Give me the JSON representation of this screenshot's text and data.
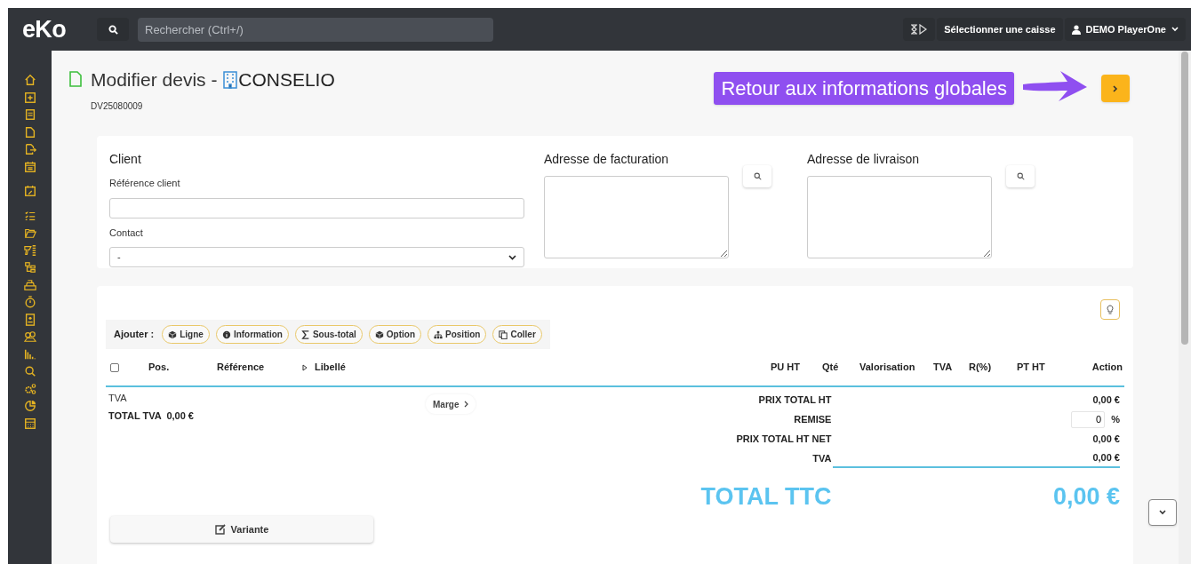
{
  "top_bar": {
    "logo": "eKo",
    "search": {
      "placeholder": "Rechercher (Ctrl+/)"
    },
    "cash_register_button": "Sélectionner une caisse",
    "user_menu": "DEMO PlayerOne"
  },
  "header": {
    "title": "Modifier devis - ",
    "client_name": "CONSELIO",
    "quote_number": "DV25080009",
    "callout": "Retour aux informations globales"
  },
  "client_card": {
    "heading": "Client",
    "fields": [
      {
        "label": "Référence client",
        "kind": "input"
      },
      {
        "label": "Contact",
        "kind": "select",
        "value": "-"
      }
    ],
    "addresses": [
      {
        "label": "Adresse de facturation"
      },
      {
        "label": "Adresse de livraison"
      }
    ]
  },
  "lines": {
    "add_label": "Ajouter :",
    "add_buttons": [
      "Ligne",
      "Information",
      "Sous-total",
      "Option",
      "Position",
      "Coller"
    ],
    "select_all": {
      "checked": false
    },
    "columns": [
      "Pos.",
      "Référence",
      "Libellé",
      "PU HT",
      "Qté",
      "Valorisation",
      "TVA",
      "R(%)",
      "PT HT",
      "Action"
    ],
    "vat_heading": "TVA",
    "vat_total": "TOTAL TVA  0,00 €",
    "margin_button": "Marge",
    "totals": [
      {
        "kind": "value",
        "label": "PRIX TOTAL HT",
        "value": "0,00 €"
      },
      {
        "kind": "input",
        "label": "REMISE",
        "value": "0",
        "unit": "%"
      },
      {
        "kind": "value",
        "label": "PRIX TOTAL HT NET",
        "value": "0,00 €"
      },
      {
        "kind": "value",
        "label": "TVA",
        "value": "0,00 €"
      },
      {
        "kind": "grand",
        "label": "TOTAL TTC",
        "value": "0,00 €"
      }
    ],
    "variant_button": "Variante"
  }
}
